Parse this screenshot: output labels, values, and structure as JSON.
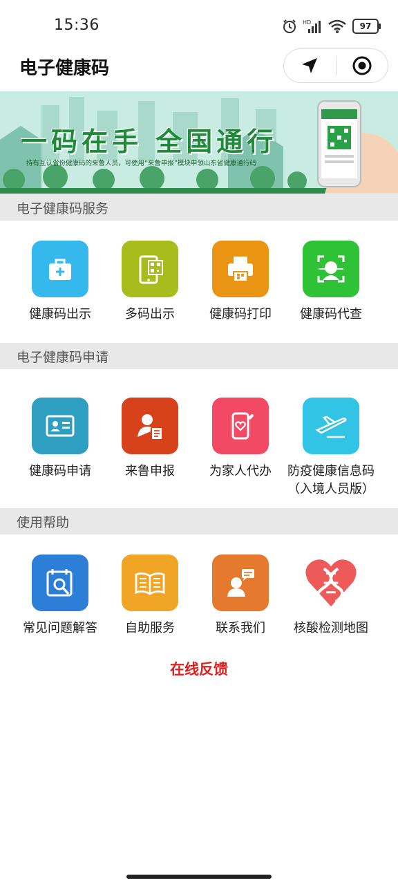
{
  "status_bar": {
    "time": "15:36",
    "battery": "97"
  },
  "header": {
    "title": "电子健康码"
  },
  "banner": {
    "slogan": "一码在手  全国通行",
    "subtitle": "持有互认省份健康码的来鲁人员，可使用“来鲁申报”模块申领山东省健康通行码"
  },
  "sections": [
    {
      "title": "电子健康码服务",
      "items": [
        {
          "label": "健康码出示",
          "icon": "medical-kit-icon",
          "color": "#35b8ec"
        },
        {
          "label": "多码出示",
          "icon": "phone-qr-icon",
          "color": "#a8bd1c"
        },
        {
          "label": "健康码打印",
          "icon": "printer-icon",
          "color": "#e99412"
        },
        {
          "label": "健康码代查",
          "icon": "face-scan-icon",
          "color": "#2fc236"
        }
      ]
    },
    {
      "title": "电子健康码申请",
      "items": [
        {
          "label": "健康码申请",
          "icon": "id-card-icon",
          "color": "#2e9fc0"
        },
        {
          "label": "来鲁申报",
          "icon": "person-form-icon",
          "color": "#d7421a"
        },
        {
          "label": "为家人代办",
          "icon": "phone-heart-icon",
          "color": "#f24a64"
        },
        {
          "label": "防疫健康信息码",
          "label2": "（入境人员版）",
          "icon": "airplane-icon",
          "color": "#32c4e4"
        }
      ]
    },
    {
      "title": "使用帮助",
      "items": [
        {
          "label": "常见问题解答",
          "icon": "calendar-search-icon",
          "color": "#2c7ed6"
        },
        {
          "label": "自助服务",
          "icon": "open-book-icon",
          "color": "#f0a526"
        },
        {
          "label": "联系我们",
          "icon": "person-chat-icon",
          "color": "#e57a2e"
        },
        {
          "label": "核酸检测地图",
          "icon": "dna-heart-icon",
          "color": "#ee5a5a"
        }
      ]
    }
  ],
  "feedback": {
    "label": "在线反馈"
  }
}
